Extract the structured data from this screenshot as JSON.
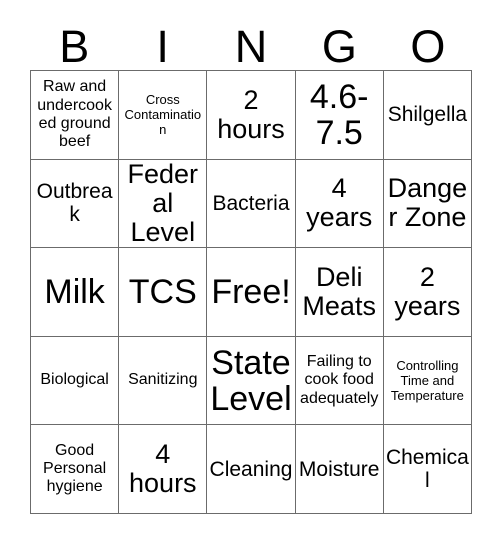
{
  "card": {
    "title": "BINGO",
    "header_letters": [
      "B",
      "I",
      "N",
      "G",
      "O"
    ],
    "free_space_label": "Free!",
    "rows": [
      [
        {
          "text": "Raw and undercooked ground beef",
          "size": "sm"
        },
        {
          "text": "Cross Contamination",
          "size": "xs"
        },
        {
          "text": "2 hours",
          "size": "lg"
        },
        {
          "text": "4.6-7.5",
          "size": "xl"
        },
        {
          "text": "Shilgella",
          "size": "md"
        }
      ],
      [
        {
          "text": "Outbreak",
          "size": "md"
        },
        {
          "text": "Federal Level",
          "size": "lg"
        },
        {
          "text": "Bacteria",
          "size": "md"
        },
        {
          "text": "4 years",
          "size": "lg"
        },
        {
          "text": "Danger Zone",
          "size": "lg"
        }
      ],
      [
        {
          "text": "Milk",
          "size": "xl"
        },
        {
          "text": "TCS",
          "size": "xl"
        },
        {
          "text": "Free!",
          "size": "xl"
        },
        {
          "text": "Deli Meats",
          "size": "lg"
        },
        {
          "text": "2 years",
          "size": "lg"
        }
      ],
      [
        {
          "text": "Biological",
          "size": "sm"
        },
        {
          "text": "Sanitizing",
          "size": "sm"
        },
        {
          "text": "State Level",
          "size": "xl"
        },
        {
          "text": "Failing to cook food adequately",
          "size": "sm"
        },
        {
          "text": "Controlling Time and Temperature",
          "size": "xs"
        }
      ],
      [
        {
          "text": "Good Personal hygiene",
          "size": "sm"
        },
        {
          "text": "4 hours",
          "size": "lg"
        },
        {
          "text": "Cleaning",
          "size": "md"
        },
        {
          "text": "Moisture",
          "size": "md"
        },
        {
          "text": "Chemical",
          "size": "md"
        }
      ]
    ]
  },
  "colors": {
    "background": "#ffffff",
    "text": "#000000",
    "grid_line": "#6b6b6b"
  }
}
